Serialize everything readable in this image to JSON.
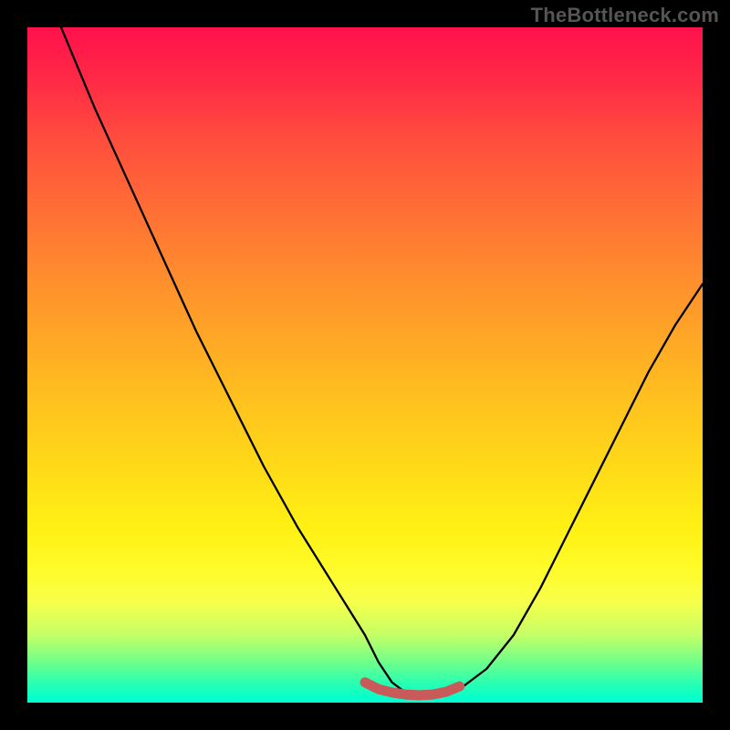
{
  "watermark": "TheBottleneck.com",
  "chart_data": {
    "type": "line",
    "title": "",
    "xlabel": "",
    "ylabel": "",
    "xlim": [
      0,
      100
    ],
    "ylim": [
      0,
      100
    ],
    "grid": false,
    "legend": false,
    "gradient_stops": [
      {
        "pos": 0,
        "color": "#ff114c"
      },
      {
        "pos": 8,
        "color": "#ff2a46"
      },
      {
        "pos": 16,
        "color": "#ff4b3e"
      },
      {
        "pos": 26,
        "color": "#ff6b36"
      },
      {
        "pos": 36,
        "color": "#ff8a2e"
      },
      {
        "pos": 46,
        "color": "#ffa726"
      },
      {
        "pos": 56,
        "color": "#ffc31e"
      },
      {
        "pos": 66,
        "color": "#ffdc18"
      },
      {
        "pos": 74,
        "color": "#fff014"
      },
      {
        "pos": 80,
        "color": "#fffb28"
      },
      {
        "pos": 85,
        "color": "#f7ff4a"
      },
      {
        "pos": 90,
        "color": "#c4ff66"
      },
      {
        "pos": 94,
        "color": "#6fff8a"
      },
      {
        "pos": 97,
        "color": "#2cffb0"
      },
      {
        "pos": 99,
        "color": "#0affc8"
      },
      {
        "pos": 100,
        "color": "#00ffd6"
      }
    ],
    "series": [
      {
        "name": "bottleneck-curve",
        "color": "#000000",
        "x": [
          5,
          10,
          15,
          20,
          25,
          30,
          35,
          40,
          45,
          50,
          52,
          54,
          56,
          58,
          60,
          62,
          64,
          68,
          72,
          76,
          80,
          84,
          88,
          92,
          96,
          100
        ],
        "y": [
          100,
          88,
          77,
          66,
          55,
          45,
          35,
          26,
          18,
          10,
          6,
          3,
          1.5,
          1,
          1,
          1.2,
          2,
          5,
          10,
          17,
          25,
          33,
          41,
          49,
          56,
          62
        ]
      },
      {
        "name": "optimal-region-highlight",
        "color": "#c85a5a",
        "x": [
          50,
          52,
          54,
          56,
          58,
          60,
          62,
          64
        ],
        "y": [
          3.0,
          2.0,
          1.5,
          1.2,
          1.1,
          1.2,
          1.6,
          2.4
        ]
      }
    ]
  }
}
